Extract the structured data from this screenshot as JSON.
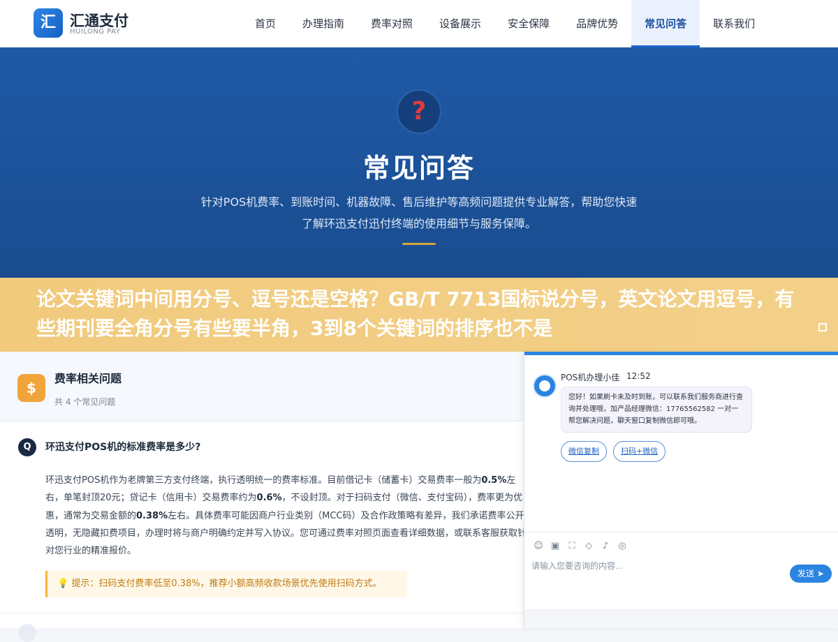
{
  "brand": {
    "logo_char": "汇",
    "name": "汇通支付",
    "sub": "HUILONG PAY"
  },
  "nav": {
    "items": [
      {
        "label": "首页"
      },
      {
        "label": "办理指南"
      },
      {
        "label": "费率对照"
      },
      {
        "label": "设备展示"
      },
      {
        "label": "安全保障"
      },
      {
        "label": "品牌优势"
      },
      {
        "label": "常见问答",
        "active": true
      },
      {
        "label": "联系我们"
      }
    ]
  },
  "hero": {
    "icon": "question-mark-icon",
    "title": "常见问答",
    "desc": "针对POS机费率、到账时间、机器故障、售后维护等高频问题提供专业解答，帮助您快速了解环迅支付迅付终端的使用细节与服务保障。"
  },
  "banner": {
    "text": "论文关键词中间用分号、逗号还是空格？GB/T 7713国标说分号，英文论文用逗号，有些期刊要全角分号有些要半角，3到8个关键词的排序也不是"
  },
  "category": {
    "icon": "money-bag-icon",
    "title": "费率相关问题",
    "count": "共 4 个常见问题"
  },
  "faq": {
    "q_badge": "Q",
    "question": "环迅支付POS机的标准费率是多少?",
    "answer_parts": [
      "环迅支付POS机作为老牌第三方支付终端，执行透明统一的费率标准。目前借记卡（储蓄卡）交易费率一般为",
      "0.5%",
      "左右，单笔封顶20元；贷记卡（信用卡）交易费率约为",
      "0.6%",
      "，不设封顶。对于扫码支付（微信、支付宝码），费率更为优惠，通常为交易金额的",
      "0.38%",
      "左右。具体费率可能因商户行业类别（MCC码）及合作政策略有差异，我们承诺费率公开透明，无隐藏扣费项目，办理时将与商户明确约定并写入协议。您可通过费率对照页面查看详细数据，或联系客服获取针对您行业的精准报价。"
    ],
    "tip": "提示：扫码支付费率低至0.38%，推荐小额高频收款场景优先使用扫码方式。"
  },
  "chat": {
    "agent_name": "POS机办理小佳",
    "time": "12:52",
    "message": "您好！如果刷卡未及时到账，可以联系我们服务商进行查询并处理哦，加产品经理微信：17765562582 一对一帮您解决问题，聊天窗口复制微信即可哦。",
    "buttons": [
      {
        "label": "微信复制"
      },
      {
        "label": "扫码+微信"
      }
    ],
    "tools": [
      "smile-icon",
      "image-icon",
      "screenshot-icon",
      "shield-icon",
      "mute-icon",
      "wechat-icon"
    ],
    "input_placeholder": "请输入您要咨询的内容...",
    "send_label": "发送"
  }
}
